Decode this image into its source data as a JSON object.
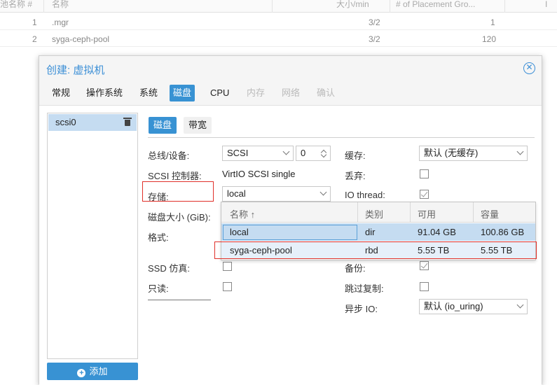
{
  "background_grid": {
    "headers": [
      "池名称 #",
      "名称",
      "大小/min",
      "# of Placement Gro...",
      "I"
    ],
    "rows": [
      {
        "num": "1",
        "name": ".mgr",
        "size": "3/2",
        "pg": "1"
      },
      {
        "num": "2",
        "name": "syga-ceph-pool",
        "size": "3/2",
        "pg": "120"
      }
    ]
  },
  "dialog": {
    "title": "创建: 虚拟机",
    "tabs": [
      {
        "label": "常规",
        "state": "normal"
      },
      {
        "label": "操作系统",
        "state": "normal"
      },
      {
        "label": "系统",
        "state": "normal"
      },
      {
        "label": "磁盘",
        "state": "active"
      },
      {
        "label": "CPU",
        "state": "normal"
      },
      {
        "label": "内存",
        "state": "disabled"
      },
      {
        "label": "网络",
        "state": "disabled"
      },
      {
        "label": "确认",
        "state": "disabled"
      }
    ],
    "disk_list": {
      "items": [
        "scsi0"
      ],
      "add_label": "添加"
    },
    "subtabs": {
      "disk": "磁盘",
      "bandwidth": "带宽"
    },
    "form": {
      "bus_label": "总线/设备:",
      "bus_value": "SCSI",
      "device_number": "0",
      "controller_label": "SCSI 控制器:",
      "controller_value": "VirtIO SCSI single",
      "storage_label": "存储:",
      "storage_value": "local",
      "disk_size_label": "磁盘大小 (GiB):",
      "format_label": "格式:",
      "ssd_label": "SSD 仿真:",
      "readonly_label": "只读:",
      "cache_label": "缓存:",
      "cache_value": "默认 (无缓存)",
      "discard_label": "丢弃:",
      "iothread_label": "IO thread:",
      "backup_label": "备份:",
      "skip_replication_label": "跳过复制:",
      "async_io_label": "异步 IO:",
      "async_io_value": "默认 (io_uring)"
    },
    "storage_dropdown": {
      "columns": [
        "名称 ↑",
        "类别",
        "可用",
        "容量"
      ],
      "rows": [
        {
          "name": "local",
          "type": "dir",
          "avail": "91.04 GB",
          "capacity": "100.86 GB"
        },
        {
          "name": "syga-ceph-pool",
          "type": "rbd",
          "avail": "5.55 TB",
          "capacity": "5.55 TB"
        }
      ]
    }
  },
  "colors": {
    "accent": "#3892d3",
    "highlight": "#e0302a",
    "selected_row": "#c5dcf1"
  }
}
